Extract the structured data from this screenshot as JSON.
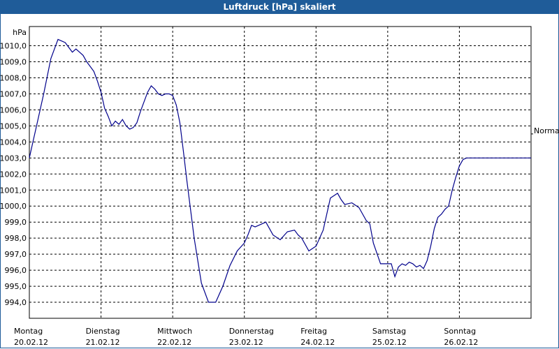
{
  "window": {
    "title": "Luftdruck [hPa] skaliert"
  },
  "chart_data": {
    "type": "line",
    "title": "Luftdruck [hPa] skaliert",
    "ylabel": "hPa",
    "xlabel": "",
    "ylim": [
      993.0,
      1011.2
    ],
    "yticks": [
      994,
      995,
      996,
      997,
      998,
      999,
      1000,
      1001,
      1002,
      1003,
      1004,
      1005,
      1006,
      1007,
      1008,
      1009,
      1010
    ],
    "ytick_labels": [
      "994,0",
      "995,0",
      "996,0",
      "997,0",
      "998,0",
      "999,0",
      "1000,0",
      "1001,0",
      "1002,0",
      "1003,0",
      "1004,0",
      "1005,0",
      "1006,0",
      "1007,0",
      "1008,0",
      "1009,0",
      "1010,0"
    ],
    "xlim": [
      0,
      7
    ],
    "days": [
      {
        "name": "Montag",
        "date": "20.02.12"
      },
      {
        "name": "Dienstag",
        "date": "21.02.12"
      },
      {
        "name": "Mittwoch",
        "date": "22.02.12"
      },
      {
        "name": "Donnerstag",
        "date": "23.02.12"
      },
      {
        "name": "Freitag",
        "date": "24.02.12"
      },
      {
        "name": "Samstag",
        "date": "25.02.12"
      },
      {
        "name": "Sonntag",
        "date": "26.02.12"
      }
    ],
    "reference_label": "Normal",
    "reference_value": 1004.5,
    "grid": true,
    "series": [
      {
        "color": "#00008b",
        "x": [
          0.0,
          0.05,
          0.1,
          0.2,
          0.3,
          0.4,
          0.5,
          0.55,
          0.6,
          0.65,
          0.7,
          0.75,
          0.8,
          0.85,
          0.9,
          0.95,
          1.0,
          1.05,
          1.1,
          1.15,
          1.2,
          1.25,
          1.3,
          1.35,
          1.4,
          1.45,
          1.5,
          1.55,
          1.6,
          1.65,
          1.7,
          1.75,
          1.8,
          1.85,
          1.9,
          1.95,
          2.0,
          2.05,
          2.1,
          2.15,
          2.2,
          2.3,
          2.4,
          2.5,
          2.6,
          2.7,
          2.8,
          2.9,
          3.0,
          3.05,
          3.1,
          3.15,
          3.2,
          3.3,
          3.4,
          3.5,
          3.6,
          3.7,
          3.75,
          3.8,
          3.9,
          4.0,
          4.1,
          4.2,
          4.3,
          4.35,
          4.4,
          4.5,
          4.6,
          4.7,
          4.75,
          4.8,
          4.9,
          5.0,
          5.05,
          5.1,
          5.15,
          5.2,
          5.25,
          5.3,
          5.35,
          5.4,
          5.45,
          5.5,
          5.55,
          5.6,
          5.65,
          5.7,
          5.75,
          5.8,
          5.85,
          5.9,
          5.95,
          6.0,
          6.05,
          6.1,
          6.15,
          6.2,
          6.25,
          6.3,
          6.35,
          6.4,
          6.45,
          6.5,
          6.55,
          6.6,
          6.65,
          6.7,
          6.75,
          6.8,
          6.85,
          6.9,
          6.95,
          7.0
        ],
        "values": [
          1003.0,
          1004.0,
          1005.0,
          1007.0,
          1009.2,
          1010.4,
          1010.2,
          1009.9,
          1009.6,
          1009.8,
          1009.6,
          1009.4,
          1009.0,
          1008.7,
          1008.4,
          1007.8,
          1007.1,
          1006.1,
          1005.6,
          1005.0,
          1005.3,
          1005.1,
          1005.4,
          1005.0,
          1004.8,
          1004.9,
          1005.2,
          1005.9,
          1006.5,
          1007.1,
          1007.5,
          1007.3,
          1007.0,
          1006.9,
          1007.0,
          1007.0,
          1006.9,
          1006.3,
          1005.2,
          1003.4,
          1001.5,
          998.0,
          995.2,
          994.0,
          994.0,
          995.0,
          996.3,
          997.2,
          997.7,
          998.2,
          998.8,
          998.7,
          998.8,
          999.0,
          998.2,
          997.9,
          998.4,
          998.5,
          998.2,
          998.0,
          997.2,
          997.5,
          998.5,
          1000.5,
          1000.8,
          1000.4,
          1000.1,
          1000.2,
          999.9,
          999.1,
          998.9,
          997.7,
          996.4,
          996.4,
          996.4,
          995.6,
          996.2,
          996.4,
          996.3,
          996.5,
          996.4,
          996.2,
          996.3,
          996.1,
          996.6,
          997.5,
          998.6,
          999.3,
          999.5,
          999.8,
          1000.0,
          1001.0,
          1001.8,
          1002.5,
          1002.9,
          1003.0,
          1003.0,
          1003.0,
          1003.0,
          1003.0,
          1003.0,
          1003.0,
          1003.0,
          1003.0,
          1003.0,
          1003.0,
          1003.0,
          1003.0,
          1003.0,
          1003.0,
          1003.0,
          1003.0,
          1003.0,
          1003.0
        ]
      }
    ]
  }
}
